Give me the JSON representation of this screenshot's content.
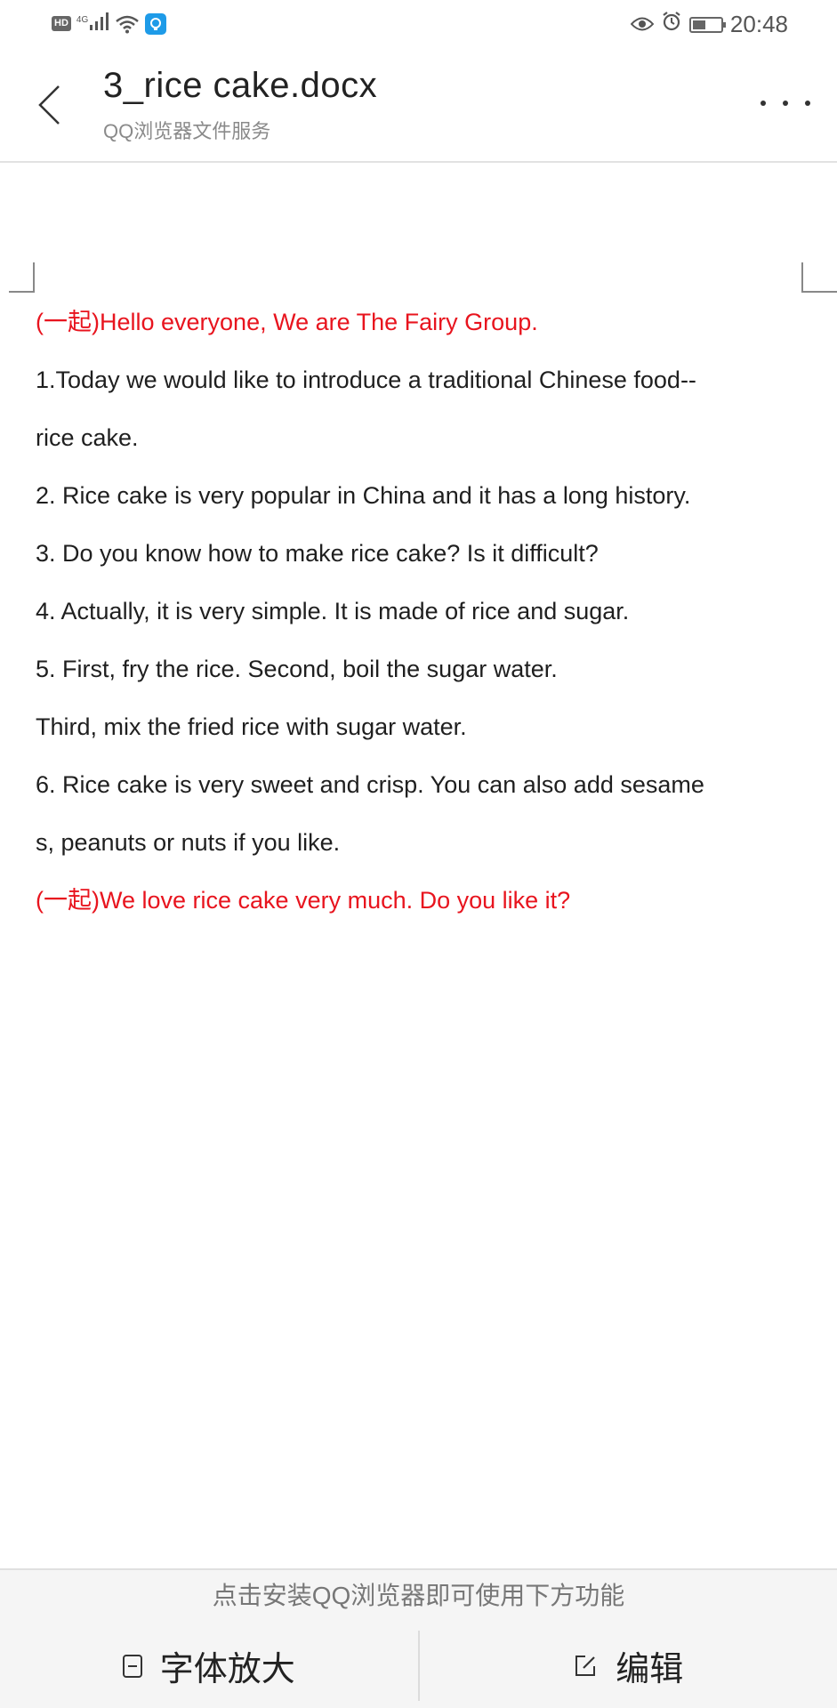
{
  "status_bar": {
    "hd": "HD",
    "network": "4G",
    "time": "20:48",
    "battery_level": 0.4,
    "icons": [
      "signal-icon",
      "wifi-icon",
      "app-notification-icon",
      "eye-icon",
      "alarm-icon",
      "battery-icon"
    ]
  },
  "header": {
    "title": "3_rice cake.docx",
    "subtitle": "QQ浏览器文件服务",
    "back_icon": "chevron-left-icon",
    "more_icon": "more-dots-icon"
  },
  "document": {
    "lines": [
      {
        "text": "(一起)Hello everyone, We are The Fairy Group.",
        "color": "#e8141e"
      },
      {
        "text": "1.Today we would like to introduce a traditional Chinese food--",
        "color": "#1f1f1f"
      },
      {
        "text": "rice cake.",
        "color": "#1f1f1f"
      },
      {
        "text": "2. Rice cake is very popular in China and it has a long history.",
        "color": "#1f1f1f"
      },
      {
        "text": "3. Do you know how to make rice cake? Is it difficult?",
        "color": "#1f1f1f"
      },
      {
        "text": "4. Actually, it is very simple. It is made of rice and sugar.",
        "color": "#1f1f1f"
      },
      {
        "text": "5. First, fry the rice. Second, boil the sugar water.",
        "color": "#1f1f1f"
      },
      {
        "text": "Third, mix the fried rice with sugar water.",
        "color": "#1f1f1f"
      },
      {
        "text": "6. Rice cake is very sweet and crisp. You can also add sesame",
        "color": "#1f1f1f"
      },
      {
        "text": "s, peanuts or nuts if you like.",
        "color": "#1f1f1f"
      },
      {
        "text": "(一起)We love rice cake very much. Do you like it?",
        "color": "#e8141e"
      }
    ]
  },
  "bottom_bar": {
    "notice": "点击安装QQ浏览器即可使用下方功能",
    "font_enlarge_label": "字体放大",
    "edit_label": "编辑"
  }
}
